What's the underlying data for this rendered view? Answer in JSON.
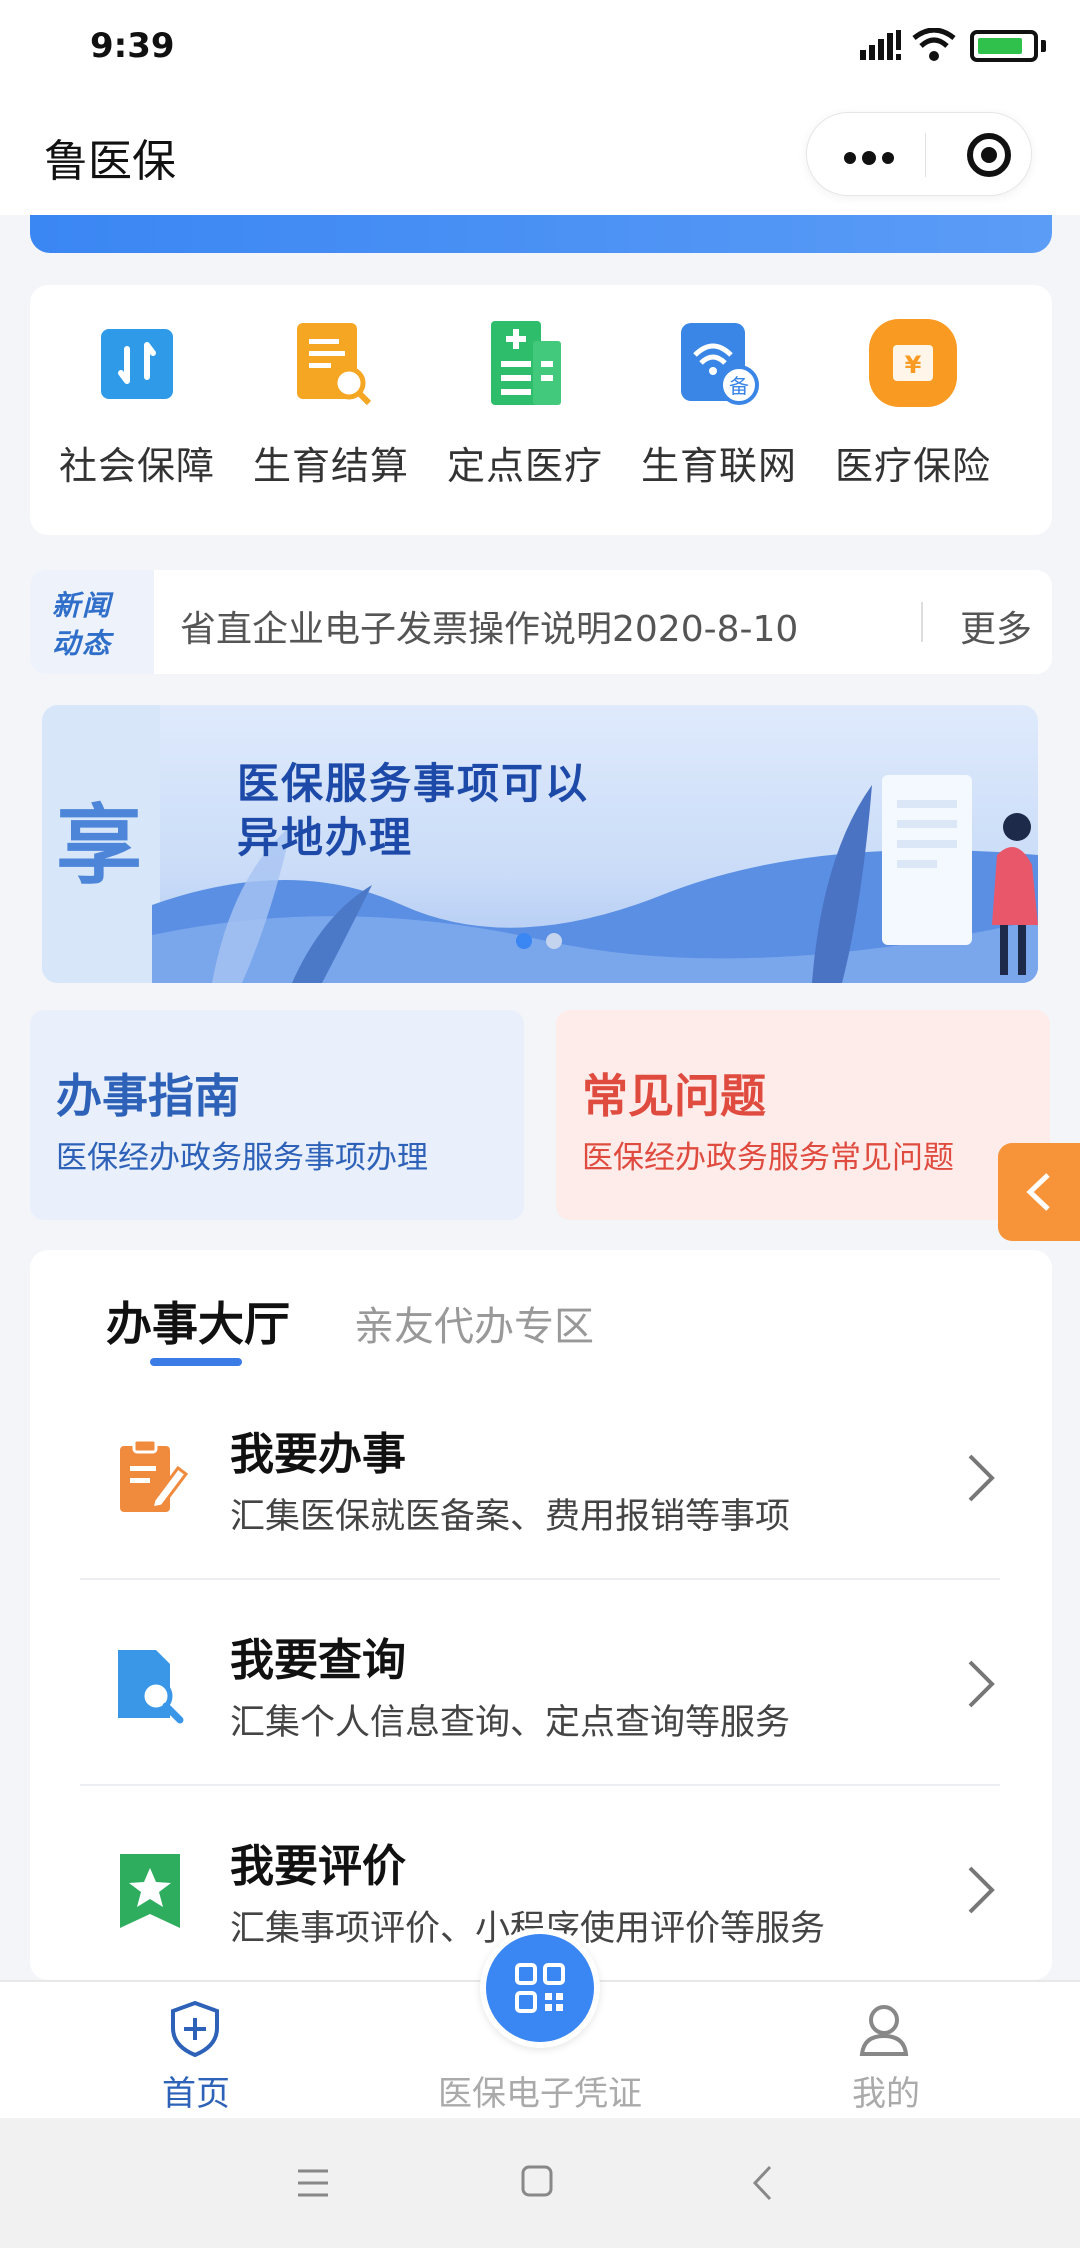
{
  "status_bar": {
    "time": "9:39"
  },
  "navbar": {
    "title": "鲁医保"
  },
  "services": [
    {
      "label": "社会保障",
      "icon": "social-security-icon"
    },
    {
      "label": "生育结算",
      "icon": "birth-settlement-icon"
    },
    {
      "label": "定点医疗",
      "icon": "designated-medical-icon"
    },
    {
      "label": "生育联网",
      "icon": "birth-network-icon"
    },
    {
      "label": "医疗保险",
      "icon": "medical-insurance-icon"
    }
  ],
  "news": {
    "tag_line1": "新闻",
    "tag_line2": "动态",
    "headline": "省直企业电子发票操作说明2020-8-10",
    "more": "更多"
  },
  "banner": {
    "badge": "享",
    "line1": "医保服务事项可以",
    "line2": "异地办理"
  },
  "guides": {
    "left": {
      "title": "办事指南",
      "subtitle": "医保经办政务服务事项办理"
    },
    "right": {
      "title": "常见问题",
      "subtitle": "医保经办政务服务常见问题"
    }
  },
  "hall": {
    "tabs": [
      "办事大厅",
      "亲友代办专区"
    ],
    "items": [
      {
        "title": "我要办事",
        "subtitle": "汇集医保就医备案、费用报销等事项"
      },
      {
        "title": "我要查询",
        "subtitle": "汇集个人信息查询、定点查询等服务"
      },
      {
        "title": "我要评价",
        "subtitle": "汇集事项评价、小程序使用评价等服务"
      }
    ]
  },
  "tabbar": {
    "home": "首页",
    "card": "医保电子凭证",
    "mine": "我的"
  },
  "colors": {
    "primary": "#3a86f3",
    "guide_left_title": "#2d62b8",
    "guide_right_title": "#e04b3f",
    "side_tab": "#f7943a"
  }
}
